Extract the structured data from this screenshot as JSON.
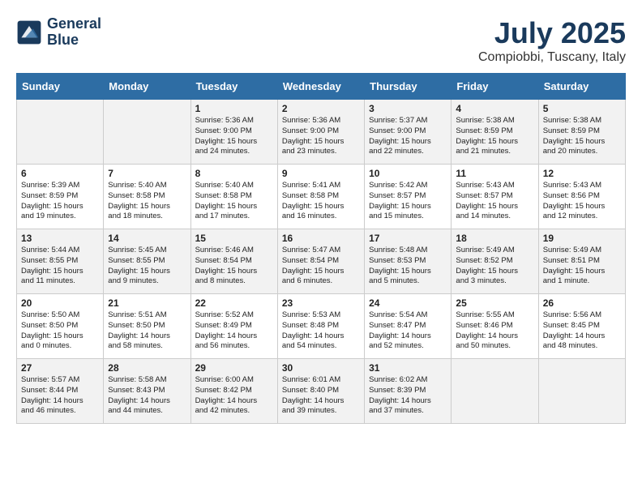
{
  "header": {
    "logo_line1": "General",
    "logo_line2": "Blue",
    "month": "July 2025",
    "location": "Compiobbi, Tuscany, Italy"
  },
  "days_of_week": [
    "Sunday",
    "Monday",
    "Tuesday",
    "Wednesday",
    "Thursday",
    "Friday",
    "Saturday"
  ],
  "weeks": [
    [
      {
        "day": "",
        "content": ""
      },
      {
        "day": "",
        "content": ""
      },
      {
        "day": "1",
        "content": "Sunrise: 5:36 AM\nSunset: 9:00 PM\nDaylight: 15 hours\nand 24 minutes."
      },
      {
        "day": "2",
        "content": "Sunrise: 5:36 AM\nSunset: 9:00 PM\nDaylight: 15 hours\nand 23 minutes."
      },
      {
        "day": "3",
        "content": "Sunrise: 5:37 AM\nSunset: 9:00 PM\nDaylight: 15 hours\nand 22 minutes."
      },
      {
        "day": "4",
        "content": "Sunrise: 5:38 AM\nSunset: 8:59 PM\nDaylight: 15 hours\nand 21 minutes."
      },
      {
        "day": "5",
        "content": "Sunrise: 5:38 AM\nSunset: 8:59 PM\nDaylight: 15 hours\nand 20 minutes."
      }
    ],
    [
      {
        "day": "6",
        "content": "Sunrise: 5:39 AM\nSunset: 8:59 PM\nDaylight: 15 hours\nand 19 minutes."
      },
      {
        "day": "7",
        "content": "Sunrise: 5:40 AM\nSunset: 8:58 PM\nDaylight: 15 hours\nand 18 minutes."
      },
      {
        "day": "8",
        "content": "Sunrise: 5:40 AM\nSunset: 8:58 PM\nDaylight: 15 hours\nand 17 minutes."
      },
      {
        "day": "9",
        "content": "Sunrise: 5:41 AM\nSunset: 8:58 PM\nDaylight: 15 hours\nand 16 minutes."
      },
      {
        "day": "10",
        "content": "Sunrise: 5:42 AM\nSunset: 8:57 PM\nDaylight: 15 hours\nand 15 minutes."
      },
      {
        "day": "11",
        "content": "Sunrise: 5:43 AM\nSunset: 8:57 PM\nDaylight: 15 hours\nand 14 minutes."
      },
      {
        "day": "12",
        "content": "Sunrise: 5:43 AM\nSunset: 8:56 PM\nDaylight: 15 hours\nand 12 minutes."
      }
    ],
    [
      {
        "day": "13",
        "content": "Sunrise: 5:44 AM\nSunset: 8:55 PM\nDaylight: 15 hours\nand 11 minutes."
      },
      {
        "day": "14",
        "content": "Sunrise: 5:45 AM\nSunset: 8:55 PM\nDaylight: 15 hours\nand 9 minutes."
      },
      {
        "day": "15",
        "content": "Sunrise: 5:46 AM\nSunset: 8:54 PM\nDaylight: 15 hours\nand 8 minutes."
      },
      {
        "day": "16",
        "content": "Sunrise: 5:47 AM\nSunset: 8:54 PM\nDaylight: 15 hours\nand 6 minutes."
      },
      {
        "day": "17",
        "content": "Sunrise: 5:48 AM\nSunset: 8:53 PM\nDaylight: 15 hours\nand 5 minutes."
      },
      {
        "day": "18",
        "content": "Sunrise: 5:49 AM\nSunset: 8:52 PM\nDaylight: 15 hours\nand 3 minutes."
      },
      {
        "day": "19",
        "content": "Sunrise: 5:49 AM\nSunset: 8:51 PM\nDaylight: 15 hours\nand 1 minute."
      }
    ],
    [
      {
        "day": "20",
        "content": "Sunrise: 5:50 AM\nSunset: 8:50 PM\nDaylight: 15 hours\nand 0 minutes."
      },
      {
        "day": "21",
        "content": "Sunrise: 5:51 AM\nSunset: 8:50 PM\nDaylight: 14 hours\nand 58 minutes."
      },
      {
        "day": "22",
        "content": "Sunrise: 5:52 AM\nSunset: 8:49 PM\nDaylight: 14 hours\nand 56 minutes."
      },
      {
        "day": "23",
        "content": "Sunrise: 5:53 AM\nSunset: 8:48 PM\nDaylight: 14 hours\nand 54 minutes."
      },
      {
        "day": "24",
        "content": "Sunrise: 5:54 AM\nSunset: 8:47 PM\nDaylight: 14 hours\nand 52 minutes."
      },
      {
        "day": "25",
        "content": "Sunrise: 5:55 AM\nSunset: 8:46 PM\nDaylight: 14 hours\nand 50 minutes."
      },
      {
        "day": "26",
        "content": "Sunrise: 5:56 AM\nSunset: 8:45 PM\nDaylight: 14 hours\nand 48 minutes."
      }
    ],
    [
      {
        "day": "27",
        "content": "Sunrise: 5:57 AM\nSunset: 8:44 PM\nDaylight: 14 hours\nand 46 minutes."
      },
      {
        "day": "28",
        "content": "Sunrise: 5:58 AM\nSunset: 8:43 PM\nDaylight: 14 hours\nand 44 minutes."
      },
      {
        "day": "29",
        "content": "Sunrise: 6:00 AM\nSunset: 8:42 PM\nDaylight: 14 hours\nand 42 minutes."
      },
      {
        "day": "30",
        "content": "Sunrise: 6:01 AM\nSunset: 8:40 PM\nDaylight: 14 hours\nand 39 minutes."
      },
      {
        "day": "31",
        "content": "Sunrise: 6:02 AM\nSunset: 8:39 PM\nDaylight: 14 hours\nand 37 minutes."
      },
      {
        "day": "",
        "content": ""
      },
      {
        "day": "",
        "content": ""
      }
    ]
  ]
}
